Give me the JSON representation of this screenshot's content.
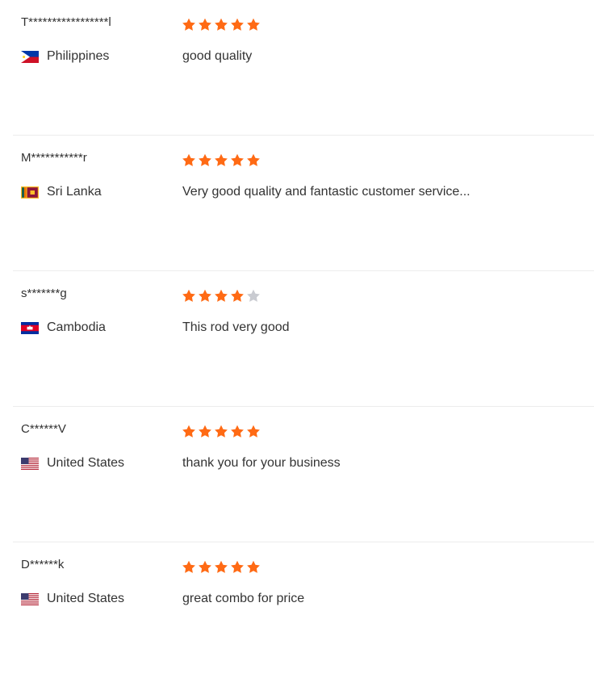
{
  "colors": {
    "star_filled": "#ff6a14",
    "star_empty": "#c9cbd1",
    "text": "#333333",
    "divider": "#ececec"
  },
  "reviews": [
    {
      "name": "T*****************l",
      "country": "Philippines",
      "flag_icon": "philippines-flag-icon",
      "rating": 5,
      "text": "good quality"
    },
    {
      "name": "M***********r",
      "country": "Sri Lanka",
      "flag_icon": "sri-lanka-flag-icon",
      "rating": 5,
      "text": "Very good quality and fantastic customer service..."
    },
    {
      "name": "s*******g",
      "country": "Cambodia",
      "flag_icon": "cambodia-flag-icon",
      "rating": 4,
      "text": "This rod very good"
    },
    {
      "name": "C******V",
      "country": "United States",
      "flag_icon": "united-states-flag-icon",
      "rating": 5,
      "text": "thank you for your business"
    },
    {
      "name": "D******k",
      "country": "United States",
      "flag_icon": "united-states-flag-icon",
      "rating": 5,
      "text": "great combo for price"
    }
  ]
}
